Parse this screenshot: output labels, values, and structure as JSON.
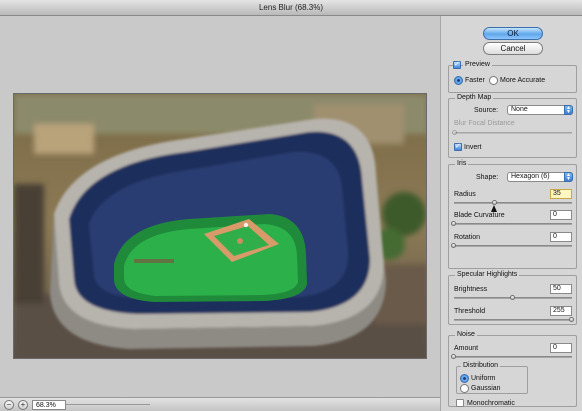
{
  "window": {
    "title": "Lens Blur (68.3%)"
  },
  "zoom": {
    "minus": "−",
    "plus": "+",
    "value": "68.3%"
  },
  "buttons": {
    "ok": "OK",
    "cancel": "Cancel"
  },
  "preview": {
    "label": "Preview",
    "checked": true,
    "faster": "Faster",
    "more_accurate": "More Accurate",
    "mode": "Faster"
  },
  "depth_map": {
    "title": "Depth Map",
    "source_label": "Source:",
    "source_value": "None",
    "blur_focal_label": "Blur Focal Distance",
    "invert_label": "Invert",
    "invert_checked": true
  },
  "iris": {
    "title": "Iris",
    "shape_label": "Shape:",
    "shape_value": "Hexagon (6)",
    "radius_label": "Radius",
    "radius_value": "35",
    "radius_fraction": 0.35,
    "blade_label": "Blade Curvature",
    "blade_value": "0",
    "blade_fraction": 0,
    "rotation_label": "Rotation",
    "rotation_value": "0",
    "rotation_fraction": 0
  },
  "specular": {
    "title": "Specular Highlights",
    "brightness_label": "Brightness",
    "brightness_value": "50",
    "brightness_fraction": 0.5,
    "threshold_label": "Threshold",
    "threshold_value": "255",
    "threshold_fraction": 1
  },
  "noise": {
    "title": "Noise",
    "amount_label": "Amount",
    "amount_value": "0",
    "amount_fraction": 0,
    "distribution_title": "Distribution",
    "uniform_label": "Uniform",
    "gaussian_label": "Gaussian",
    "distribution": "Uniform",
    "mono_label": "Monochromatic",
    "mono_checked": false
  }
}
